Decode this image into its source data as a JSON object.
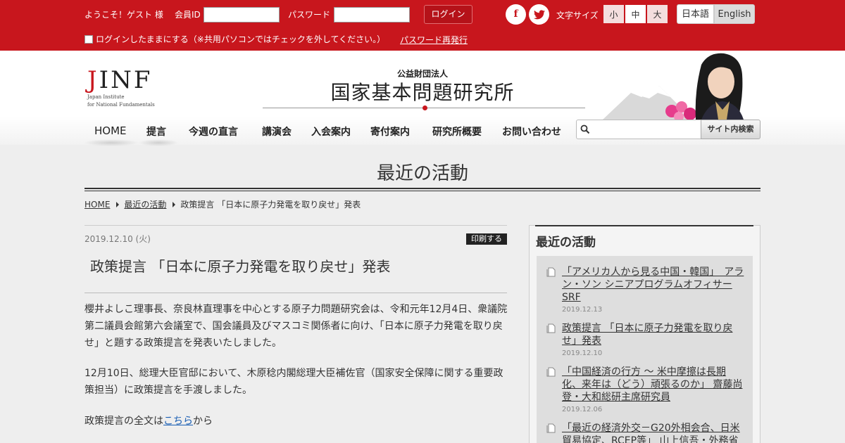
{
  "topbar": {
    "welcome": "ようこそ！ゲスト 様",
    "member_id_label": "会員ID",
    "member_id_value": "",
    "password_label": "パスワード",
    "password_value": "",
    "login_label": "ログイン",
    "facebook_glyph": "f",
    "twitter_glyph": "t",
    "font_size_label": "文字サイズ",
    "font_small": "小",
    "font_medium": "中",
    "font_large": "大",
    "lang_ja": "日本語",
    "lang_en": "English",
    "keep_login": "ログインしたままにする（※共用パソコンではチェックを外してください。）",
    "reissue_password": "パスワード再発行"
  },
  "header": {
    "logo_letters": "INF",
    "logo_j": "J",
    "logo_sub1": "Japan Institute",
    "logo_sub2": "for National Fundamentals",
    "org_prefix": "公益財団法人",
    "org_name": "国家基本問題研究所"
  },
  "nav": {
    "home": "HOME",
    "proposals": "提言",
    "weekly": "今週の直言",
    "lectures": "講演会",
    "membership": "入会案内",
    "donation": "寄付案内",
    "about": "研究所概要",
    "contact": "お問い合わせ",
    "search_placeholder": "",
    "search_button": "サイト内検索"
  },
  "page": {
    "title": "最近の活動"
  },
  "breadcrumb": {
    "home": "HOME",
    "section": "最近の活動",
    "current": "政策提言 「日本に原子力発電を取り戻せ」発表"
  },
  "article": {
    "date": "2019.12.10 (火)",
    "print": "印刷する",
    "title": "政策提言 「日本に原子力発電を取り戻せ」発表",
    "p1": "櫻井よしこ理事長、奈良林直理事を中心とする原子力問題研究会は、令和元年12月4日、衆議院第二議員会館第六会議室で、国会議員及びマスコミ関係者に向け、「日本に原子力発電を取り戻せ」と題する政策提言を発表いたしました。",
    "p2": "12月10日、総理大臣官邸において、木原稔内閣総理大臣補佐官（国家安全保障に関する重要政策担当）に政策提言を手渡しました。",
    "p3_before": "政策提言の全文は",
    "p3_link": "こちら",
    "p3_after": "から"
  },
  "sidebar": {
    "title": "最近の活動",
    "items": [
      {
        "title": "「アメリカ人から見る中国・韓国」　アラン・ソン シニアプログラムオフィサーSRF",
        "date": "2019.12.13"
      },
      {
        "title": "政策提言 「日本に原子力発電を取り戻せ」発表",
        "date": "2019.12.10"
      },
      {
        "title": "「中国経済の行方 ～ 米中摩擦は長期化、来年は（どう）頑張るのか」 齋藤尚登・大和総研主席研究員",
        "date": "2019.12.06"
      },
      {
        "title": "「最近の経済外交－G20外相会合、日米貿易協定、RCEP等」 山上信吾・外務省",
        "date": ""
      }
    ]
  },
  "colors": {
    "brand_red": "#c8161d",
    "link_blue": "#1a5fb4"
  },
  "icons": {
    "facebook": "facebook-icon",
    "twitter": "twitter-icon",
    "search": "search-icon",
    "document": "document-icon"
  }
}
